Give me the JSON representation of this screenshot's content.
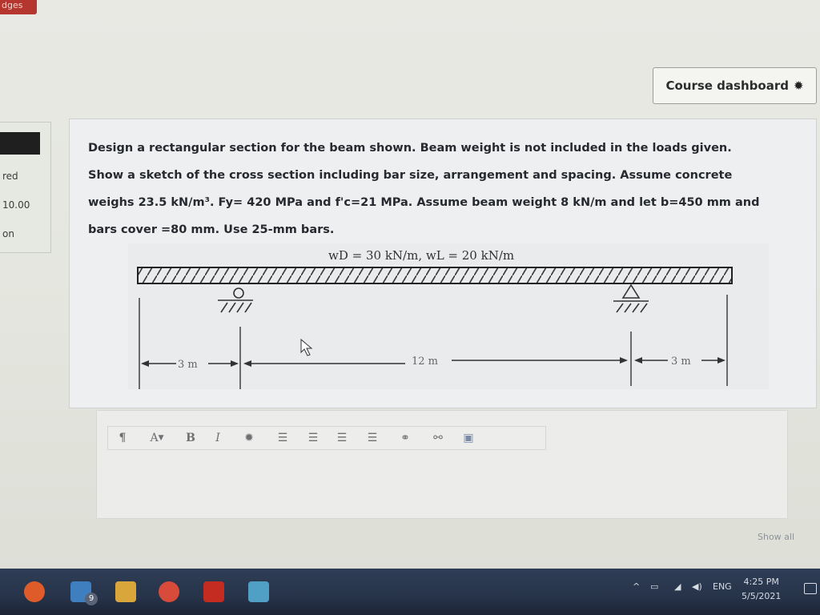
{
  "corner_tab": "dges",
  "header": {
    "dashboard_button": "Course dashboard"
  },
  "left_panel": {
    "line1": "red",
    "line2": "10.00",
    "line3": "on"
  },
  "question": {
    "line1": "Design a rectangular section for the beam shown. Beam weight is not included in the loads given.",
    "line2": "Show a sketch of the cross section including bar size, arrangement and spacing. Assume concrete",
    "line3": "weighs 23.5 kN/m³. Fy= 420 MPa and f'c=21 MPa. Assume beam weight 8 kN/m and let b=450 mm and",
    "line4": "bars cover =80 mm. Use 25-mm bars."
  },
  "figure": {
    "load_label": "wD = 30 kN/m, wL = 20 kN/m",
    "span_left": "3 m",
    "span_mid": "12 m",
    "span_right": "3 m"
  },
  "editor": {
    "toolbar": {
      "paragraph": "¶",
      "font_color": "A",
      "bold": "B",
      "italic": "I"
    },
    "show_all": "Show all"
  },
  "taskbar": {
    "mail_badge": "9",
    "language": "ENG",
    "time": "4:25 PM",
    "date": "5/5/2021"
  },
  "colors": {
    "accent_red": "#b5362f",
    "taskbar": "#2e3d56",
    "question_text": "#262a30"
  }
}
